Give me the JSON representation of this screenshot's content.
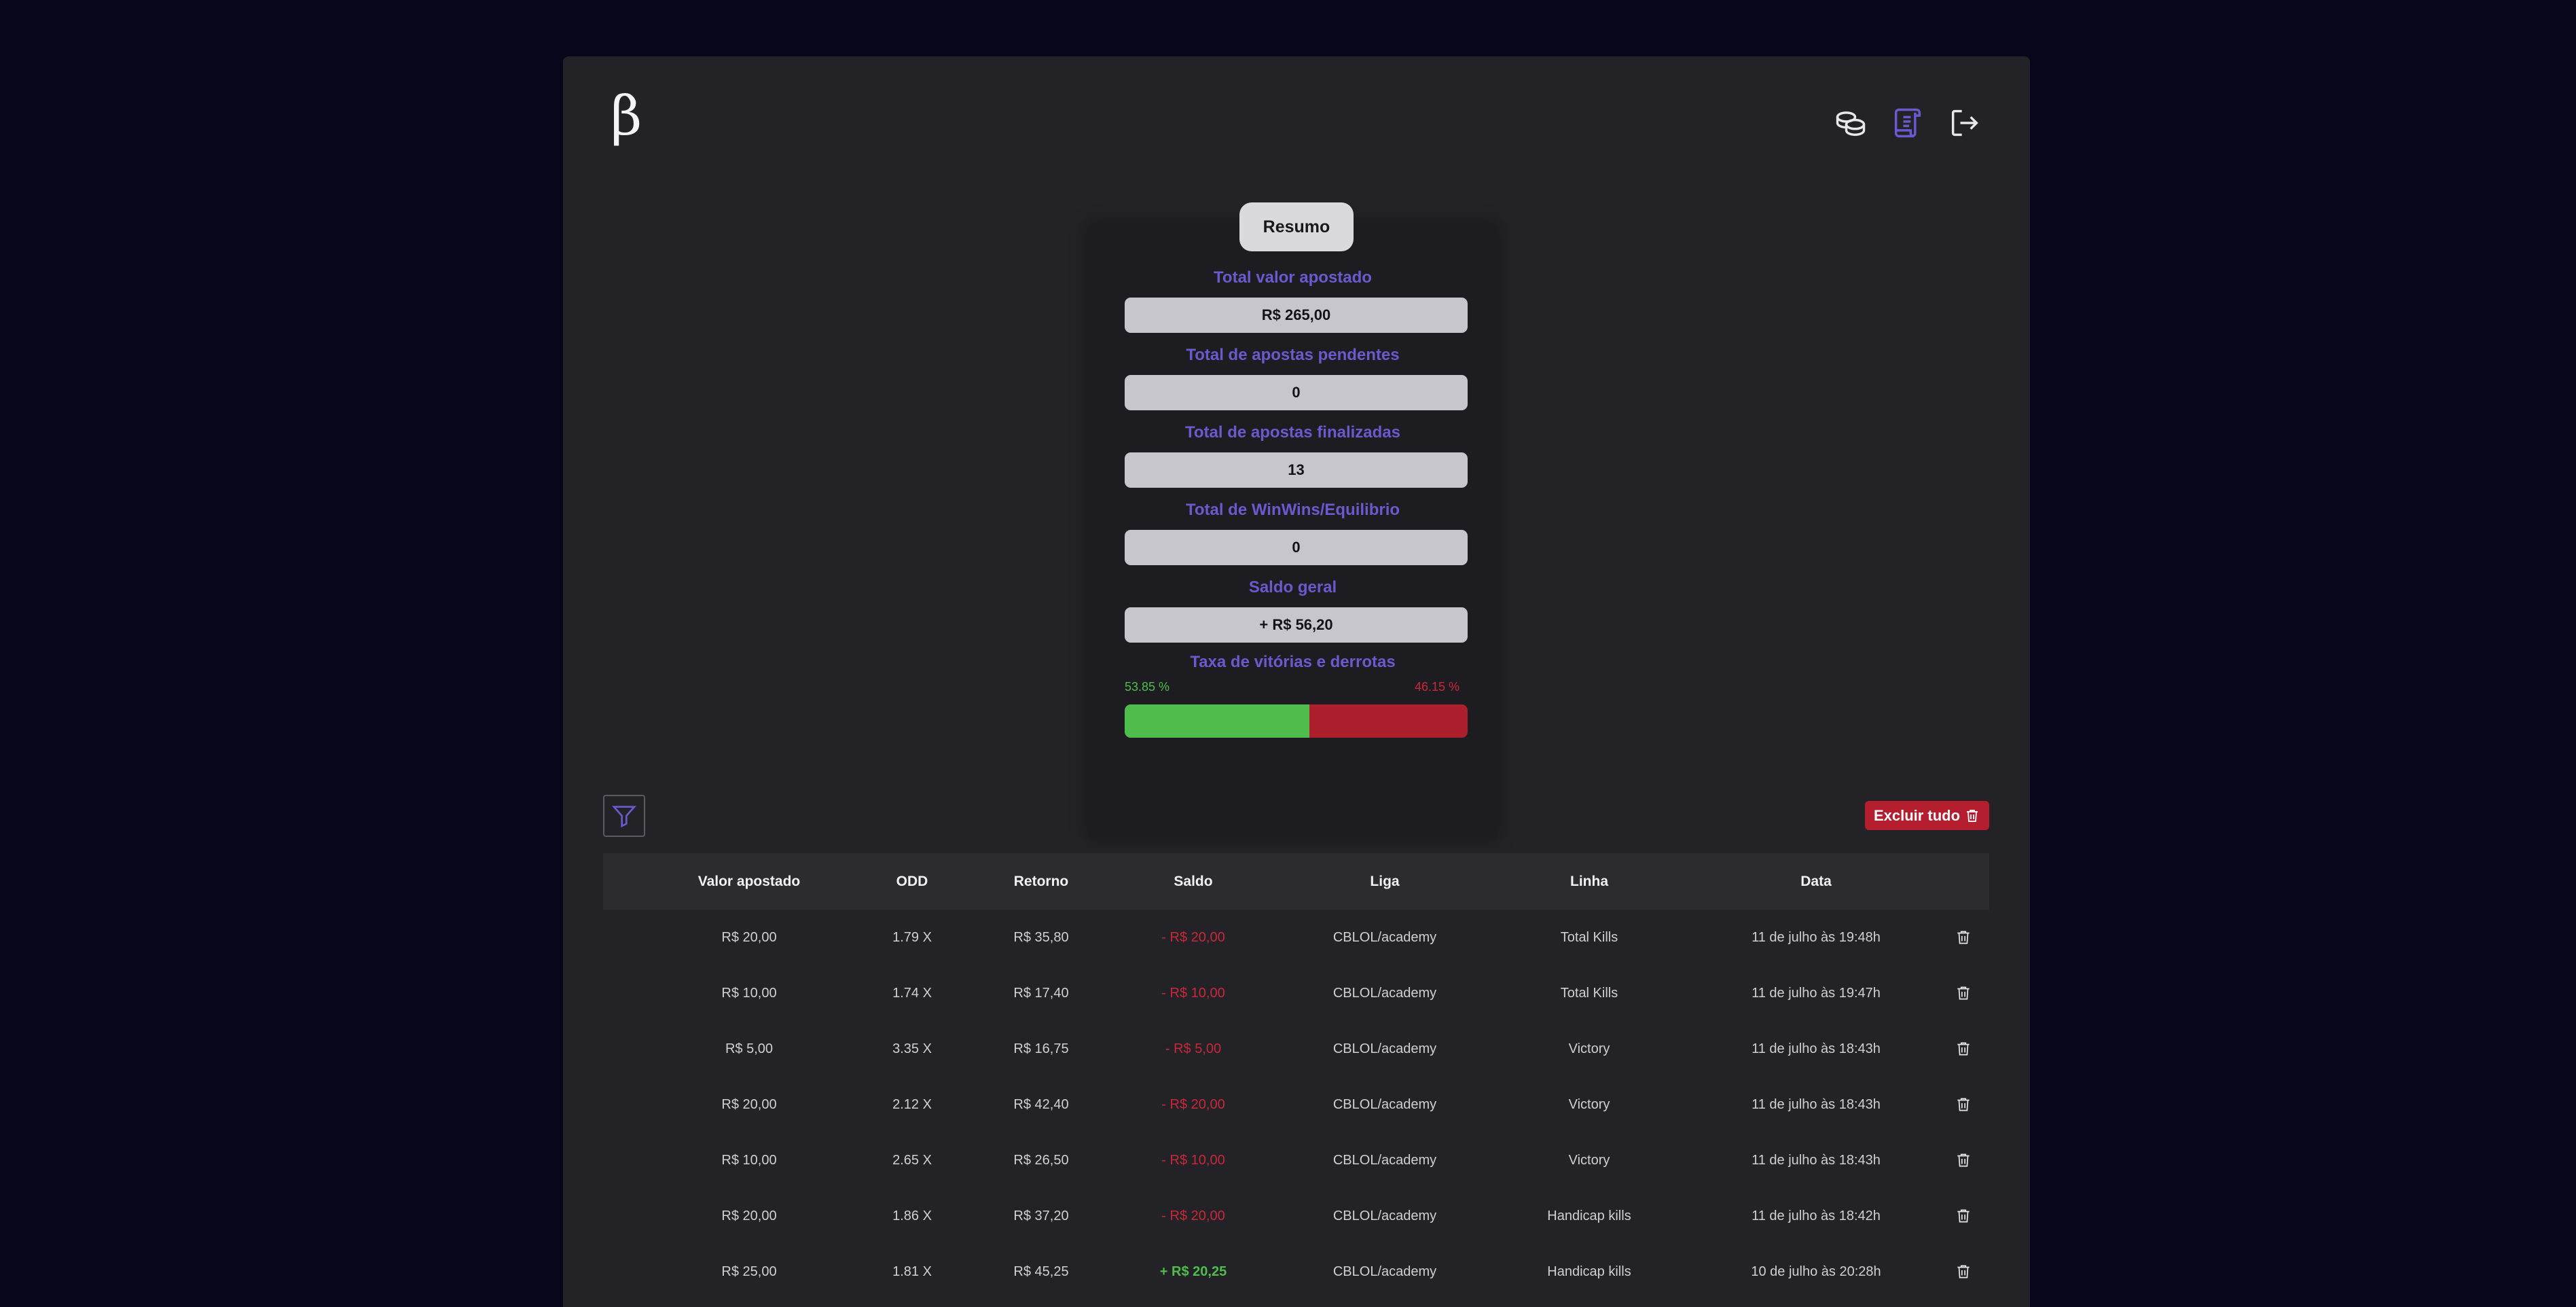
{
  "header": {
    "logo": "β",
    "icons": [
      "coins-icon",
      "scroll-icon",
      "logout-icon"
    ]
  },
  "summary": {
    "tab_label": "Resumo",
    "stats": [
      {
        "label": "Total valor apostado",
        "value": "R$ 265,00"
      },
      {
        "label": "Total de apostas pendentes",
        "value": "0"
      },
      {
        "label": "Total de apostas finalizadas",
        "value": "13"
      },
      {
        "label": "Total de WinWins/Equilibrio",
        "value": "0"
      },
      {
        "label": "Saldo geral",
        "value": "+ R$ 56,20"
      }
    ],
    "ratio": {
      "label": "Taxa de vitórias e derrotas",
      "win_text": "53.85 %",
      "loss_text": "46.15 %",
      "win_fraction": 0.5385
    }
  },
  "toolbar": {
    "filter_icon": "filter-icon",
    "delete_all_label": "Excluir tudo"
  },
  "table": {
    "headers": [
      "Valor apostado",
      "ODD",
      "Retorno",
      "Saldo",
      "Liga",
      "Linha",
      "Data"
    ],
    "rows": [
      {
        "valor": "R$ 20,00",
        "odd": "1.79 X",
        "retorno": "R$ 35,80",
        "saldo": "- R$ 20,00",
        "liga": "CBLOL/academy",
        "linha": "Total Kills",
        "data": "11 de julho às 19:48h"
      },
      {
        "valor": "R$ 10,00",
        "odd": "1.74 X",
        "retorno": "R$ 17,40",
        "saldo": "- R$ 10,00",
        "liga": "CBLOL/academy",
        "linha": "Total Kills",
        "data": "11 de julho às 19:47h"
      },
      {
        "valor": "R$ 5,00",
        "odd": "3.35 X",
        "retorno": "R$ 16,75",
        "saldo": "- R$ 5,00",
        "liga": "CBLOL/academy",
        "linha": "Victory",
        "data": "11 de julho às 18:43h"
      },
      {
        "valor": "R$ 20,00",
        "odd": "2.12 X",
        "retorno": "R$ 42,40",
        "saldo": "- R$ 20,00",
        "liga": "CBLOL/academy",
        "linha": "Victory",
        "data": "11 de julho às 18:43h"
      },
      {
        "valor": "R$ 10,00",
        "odd": "2.65 X",
        "retorno": "R$ 26,50",
        "saldo": "- R$ 10,00",
        "liga": "CBLOL/academy",
        "linha": "Victory",
        "data": "11 de julho às 18:43h"
      },
      {
        "valor": "R$ 20,00",
        "odd": "1.86 X",
        "retorno": "R$ 37,20",
        "saldo": "- R$ 20,00",
        "liga": "CBLOL/academy",
        "linha": "Handicap kills",
        "data": "11 de julho às 18:42h"
      },
      {
        "valor": "R$ 25,00",
        "odd": "1.81 X",
        "retorno": "R$ 45,25",
        "saldo": "+ R$ 20,25",
        "liga": "CBLOL/academy",
        "linha": "Handicap kills",
        "data": "10 de julho às 20:28h"
      }
    ]
  },
  "colors": {
    "background": "#07061a",
    "panel": "#232327",
    "accent": "#6a5acd",
    "win": "#4fbd4c",
    "loss": "#c8283a"
  }
}
